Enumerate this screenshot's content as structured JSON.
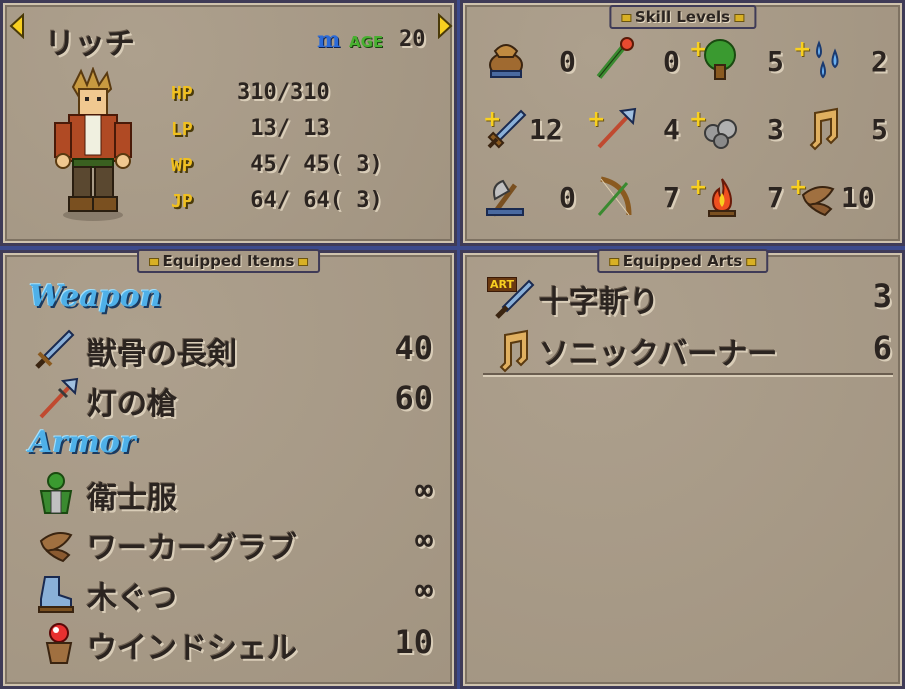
{
  "character": {
    "name": "リッチ",
    "class_badge": "m",
    "age_label": "AGE",
    "age_value": "20"
  },
  "stats": [
    {
      "label": "HP",
      "value": "310/310"
    },
    {
      "label": "LP",
      "value": " 13/ 13"
    },
    {
      "label": "WP",
      "value": " 45/ 45( 3)"
    },
    {
      "label": "JP",
      "value": " 64/ 64( 3)"
    }
  ],
  "skill_levels": {
    "title": "Skill Levels",
    "rows": [
      [
        {
          "icon": "bag-icon",
          "value": "0",
          "plus": false
        },
        {
          "icon": "staff-icon",
          "value": "0",
          "plus": false
        },
        {
          "icon": "tree-icon",
          "value": "5",
          "plus": true
        },
        {
          "icon": "water-drops-icon",
          "value": "2",
          "plus": true
        }
      ],
      [
        {
          "icon": "sword-icon",
          "value": "12",
          "plus": true
        },
        {
          "icon": "spear-icon",
          "value": "4",
          "plus": true
        },
        {
          "icon": "rocks-icon",
          "value": "3",
          "plus": true
        },
        {
          "icon": "music-note-icon",
          "value": "5",
          "plus": false
        }
      ],
      [
        {
          "icon": "axe-icon",
          "value": "0",
          "plus": false
        },
        {
          "icon": "bow-icon",
          "value": "7",
          "plus": false
        },
        {
          "icon": "fire-icon",
          "value": "7",
          "plus": true
        },
        {
          "icon": "wind-icon",
          "value": "10",
          "plus": true
        }
      ]
    ]
  },
  "equipped_items": {
    "title": "Equipped Items",
    "weapon_label": "Weapon",
    "armor_label": "Armor",
    "weapons": [
      {
        "icon": "sword-icon",
        "name": "獣骨の長剣",
        "value": "40"
      },
      {
        "icon": "spear-icon",
        "name": "灯の槍",
        "value": "60"
      }
    ],
    "armor": [
      {
        "icon": "tunic-icon",
        "name": "衛士服",
        "value": "∞"
      },
      {
        "icon": "glove-icon",
        "name": "ワーカーグラブ",
        "value": "∞"
      },
      {
        "icon": "shoe-icon",
        "name": "木ぐつ",
        "value": "∞"
      },
      {
        "icon": "shell-icon",
        "name": "ウインドシェル",
        "value": "10"
      }
    ]
  },
  "equipped_arts": {
    "title": "Equipped Arts",
    "arts": [
      {
        "icon": "sword-art-icon",
        "badge": "ART",
        "name": "十字斬り",
        "value": "3"
      },
      {
        "icon": "music-note-icon",
        "badge": "",
        "name": "ソニックバーナー",
        "value": "6"
      }
    ]
  },
  "colors": {
    "panel": "#a89a86",
    "border": "#3f3b57",
    "stat_label": "#f0c020",
    "section_title": "#4fb0e8",
    "background": "#3c4a8c"
  }
}
